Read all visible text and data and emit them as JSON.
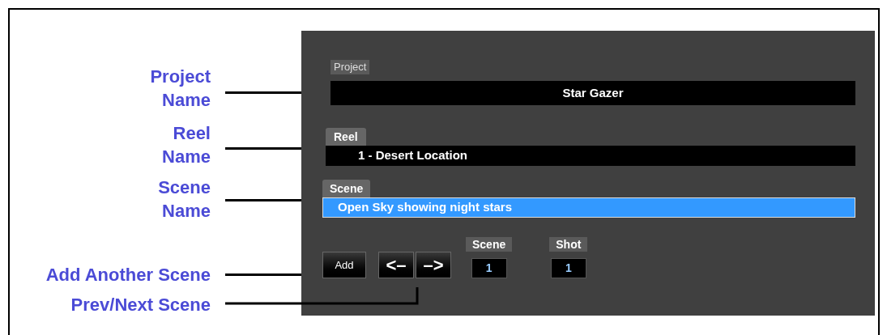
{
  "callouts": [
    {
      "text": "Project Name",
      "kind": "project"
    },
    {
      "text": "Reel Name",
      "kind": "reel"
    },
    {
      "text": "Scene Name",
      "kind": "scene"
    },
    {
      "text": "Add Another Scene",
      "kind": "add"
    },
    {
      "text": "Prev/Next Scene",
      "kind": "nav"
    }
  ],
  "panel": {
    "project": {
      "label": "Project",
      "value": "Star Gazer"
    },
    "reel": {
      "label": "Reel",
      "value": "1 - Desert Location"
    },
    "scene": {
      "label": "Scene",
      "value": "Open Sky showing night stars",
      "selected": true
    },
    "buttons": [
      {
        "label": "Add",
        "kind": "add"
      },
      {
        "label": "<–",
        "kind": "prev"
      },
      {
        "label": "–>",
        "kind": "next"
      }
    ],
    "counters": [
      {
        "label": "Scene",
        "value": "1"
      },
      {
        "label": "Shot",
        "value": "1"
      }
    ]
  }
}
